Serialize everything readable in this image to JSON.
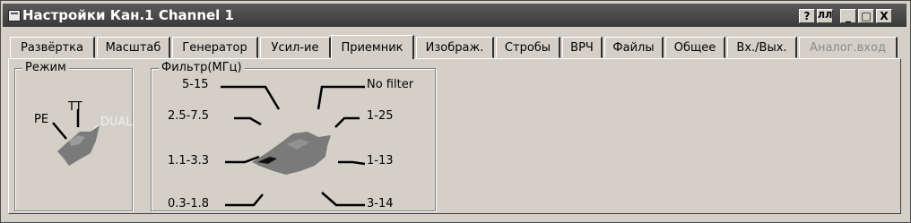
{
  "window": {
    "title": "Настройки Кан.1 Channel 1",
    "buttons": {
      "help": "?",
      "graph": "ЛЛ",
      "minimize": "_",
      "maximize": "□",
      "close": "X"
    }
  },
  "tabs": [
    {
      "label": "Развёртка"
    },
    {
      "label": "Масштаб"
    },
    {
      "label": "Генератор"
    },
    {
      "label": "Усил-ие"
    },
    {
      "label": "Приемник",
      "active": true
    },
    {
      "label": "Изображ."
    },
    {
      "label": "Стробы"
    },
    {
      "label": "ВРЧ"
    },
    {
      "label": "Файлы"
    },
    {
      "label": "Общее"
    },
    {
      "label": "Вх./Вых."
    },
    {
      "label": "Аналог.вход",
      "disabled": true
    }
  ],
  "mode": {
    "title": "Режим",
    "options": {
      "pe": "PE",
      "tt": "TT",
      "dual": "DUAL"
    },
    "selected": "PE"
  },
  "filter": {
    "title": "Фильтр(МГц)",
    "options": {
      "f5_15": "5-15",
      "f25_75": "2.5-7.5",
      "f11_33": "1.1-3.3",
      "f03_18": "0.3-1.8",
      "nofilter": "No filter",
      "f1_25": "1-25",
      "f1_13": "1-13",
      "f3_14": "3-14"
    },
    "selected": "1.1-3.3"
  }
}
